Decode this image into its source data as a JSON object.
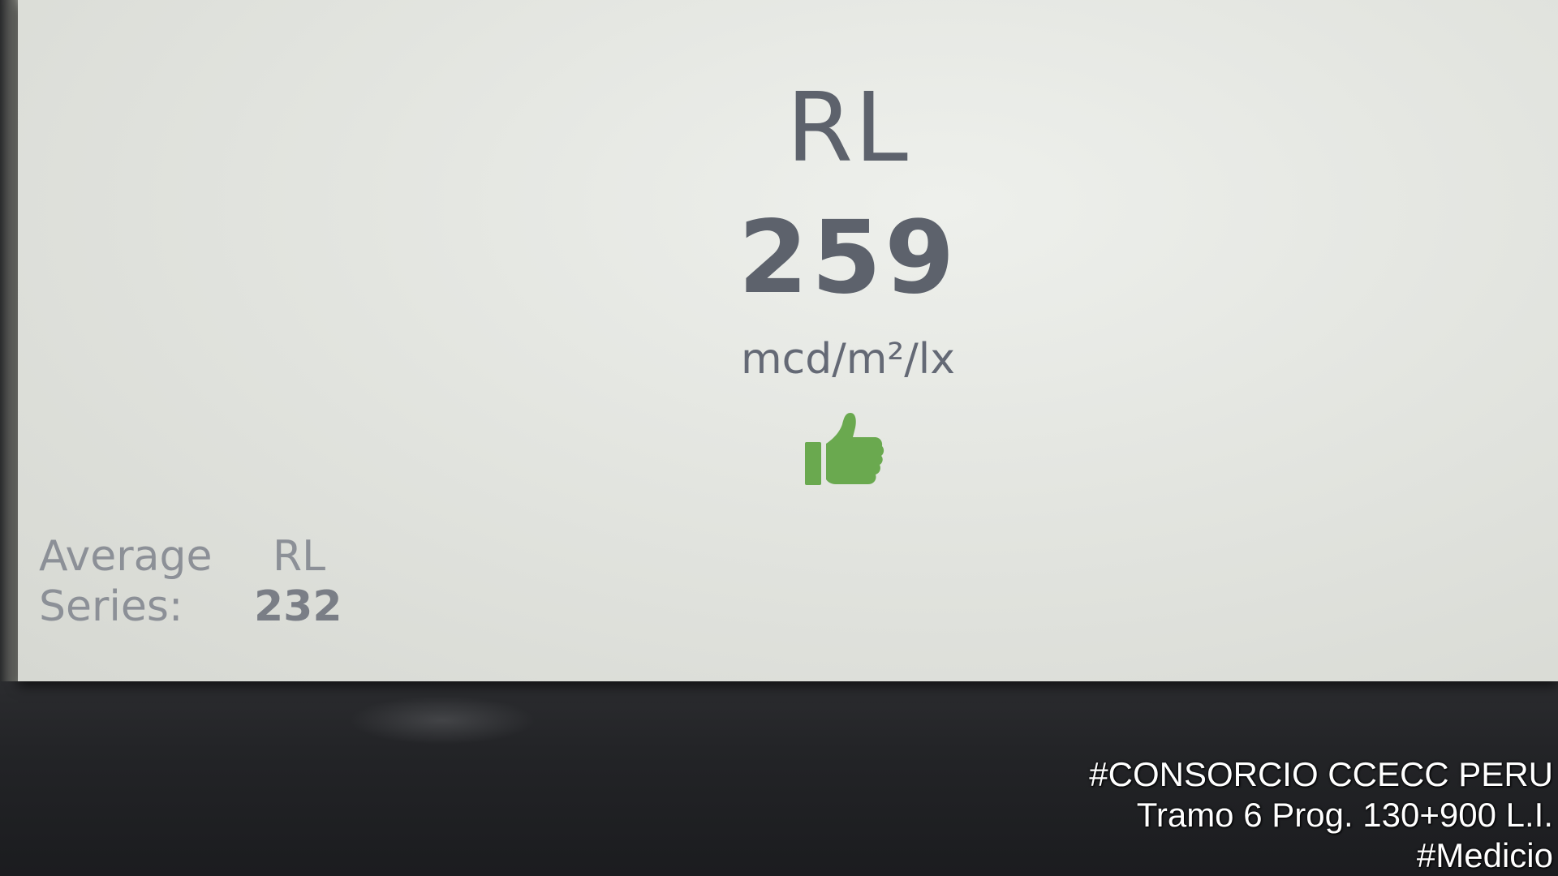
{
  "reading": {
    "label": "RL",
    "value": "259",
    "unit": "mcd/m²/lx",
    "status_icon": "thumbs-up-icon",
    "status_color": "#6aa94f"
  },
  "average": {
    "label_line1": "Average",
    "label_line1_b": "RL",
    "label_line2": "Series:",
    "value": "232"
  },
  "watermark": {
    "line1": "#CONSORCIO CCECC PERU",
    "line2": "Tramo 6 Prog. 130+900 L.I.",
    "line3": "#Medicio"
  },
  "colors": {
    "screen_bg": "#e3e5e0",
    "text": "#5d626c",
    "bezel": "#1c1d20"
  }
}
